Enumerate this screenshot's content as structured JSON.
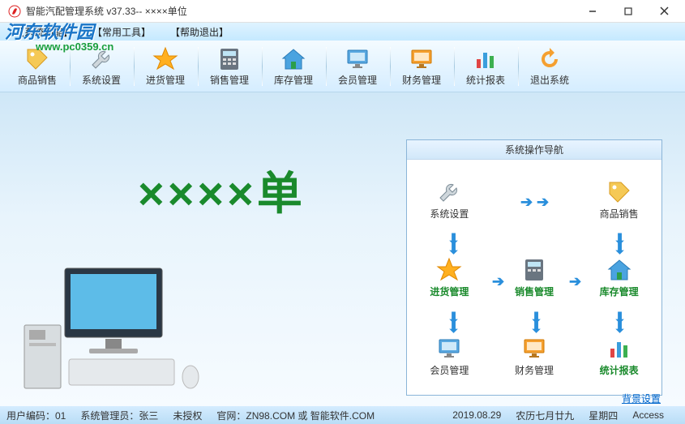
{
  "title": "智能汽配管理系统 v37.33-- ××××单位",
  "menus": {
    "m1": "【系统功能】",
    "m2": "【常用工具】",
    "m3": "【帮助退出】"
  },
  "toolbar": {
    "t1": "商品销售",
    "t2": "系统设置",
    "t3": "进货管理",
    "t4": "销售管理",
    "t5": "库存管理",
    "t6": "会员管理",
    "t7": "财务管理",
    "t8": "统计报表",
    "t9": "退出系统"
  },
  "watermark": {
    "line1": "河东软件园",
    "line2": "www.pc0359.cn"
  },
  "center_text": "××××单",
  "nav_title": "系统操作导航",
  "nav": {
    "n1": "系统设置",
    "n2": "商品销售",
    "n3": "进货管理",
    "n4": "销售管理",
    "n5": "库存管理",
    "n6": "会员管理",
    "n7": "财务管理",
    "n8": "统计报表"
  },
  "bg_link": "背景设置",
  "status": {
    "s1": "用户编码：01",
    "s2": "系统管理员：张三",
    "s3": "未授权",
    "s4": "官网：ZN98.COM 或 智能软件.COM",
    "s5": "2019.08.29",
    "s6": "农历七月廿九",
    "s7": "星期四",
    "s8": "Access"
  }
}
